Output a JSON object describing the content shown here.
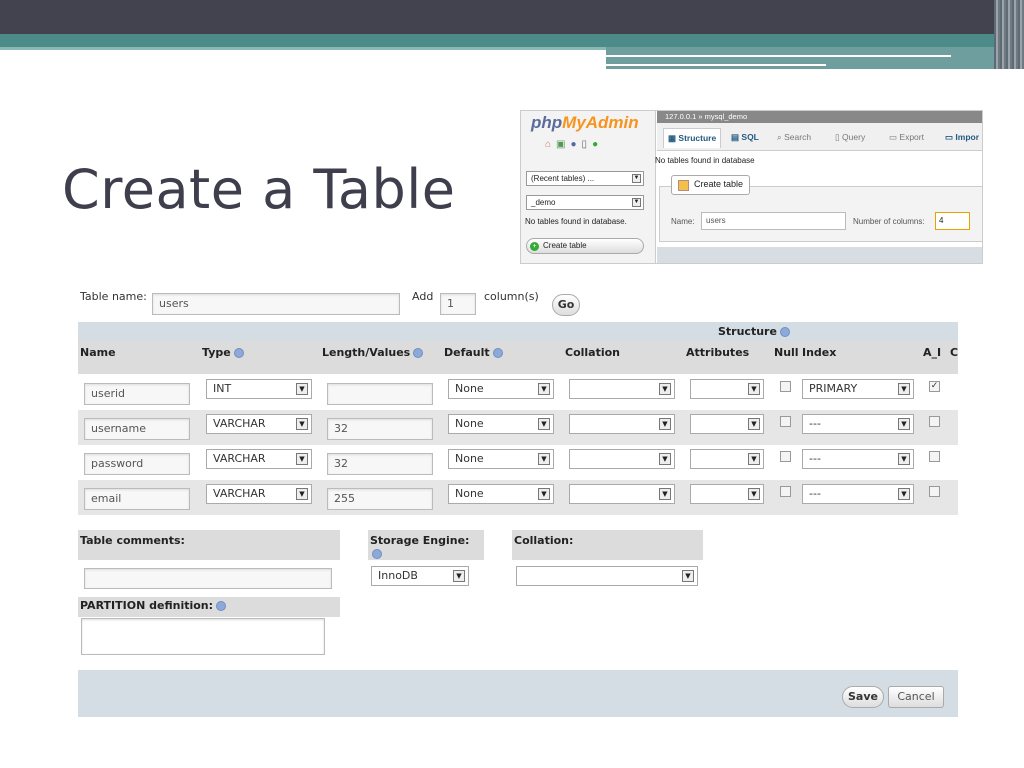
{
  "slide": {
    "title": "Create a Table"
  },
  "pma": {
    "logo_php": "php",
    "logo_myadmin": "MyAdmin",
    "recent_tables": "(Recent tables) ...",
    "db_select": "_demo",
    "no_tables_left": "No tables found in database.",
    "create_table_left": "Create table",
    "breadcrumb": "127.0.0.1 » mysql_demo",
    "tabs": [
      "Structure",
      "SQL",
      "Search",
      "Query",
      "Export",
      "Impor"
    ],
    "no_tables_main": "No tables found in database",
    "create_table_legend": "Create table",
    "name_label": "Name:",
    "name_value": "users",
    "cols_label": "Number of columns:",
    "cols_value": "4"
  },
  "form": {
    "table_name_label": "Table name:",
    "table_name_value": "users",
    "add_label": "Add",
    "add_value": "1",
    "columns_label": "column(s)",
    "go_label": "Go",
    "structure_label": "Structure",
    "headers": [
      "Name",
      "Type",
      "Length/Values",
      "Default",
      "Collation",
      "Attributes",
      "Null",
      "Index",
      "A_I",
      "C"
    ],
    "rows": [
      {
        "name": "userid",
        "type": "INT",
        "length": "",
        "default": "None",
        "index": "PRIMARY",
        "ai": "✓"
      },
      {
        "name": "username",
        "type": "VARCHAR",
        "length": "32",
        "default": "None",
        "index": "---",
        "ai": ""
      },
      {
        "name": "password",
        "type": "VARCHAR",
        "length": "32",
        "default": "None",
        "index": "---",
        "ai": ""
      },
      {
        "name": "email",
        "type": "VARCHAR",
        "length": "255",
        "default": "None",
        "index": "---",
        "ai": ""
      }
    ],
    "table_comments_label": "Table comments:",
    "storage_engine_label": "Storage Engine:",
    "storage_engine_value": "InnoDB",
    "collation_label": "Collation:",
    "partition_label": "PARTITION definition:",
    "save_label": "Save",
    "cancel_label": "Cancel"
  }
}
